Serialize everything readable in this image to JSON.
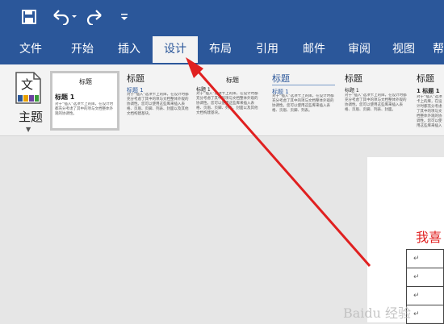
{
  "quick_access": {
    "save_icon": "save-icon",
    "undo_icon": "undo-icon",
    "redo_icon": "redo-icon",
    "customize_icon": "customize-toolbar-icon"
  },
  "tabs": [
    {
      "label": "文件"
    },
    {
      "label": "开始"
    },
    {
      "label": "插入"
    },
    {
      "label": "设计",
      "active": true
    },
    {
      "label": "布局"
    },
    {
      "label": "引用"
    },
    {
      "label": "邮件"
    },
    {
      "label": "审阅"
    },
    {
      "label": "视图"
    },
    {
      "label": "帮"
    }
  ],
  "ribbon": {
    "theme": {
      "icon_text": "文",
      "label": "主题"
    },
    "styles": [
      {
        "title": "标题",
        "heading": "标题 1",
        "body": "对于“插入”选项卡上的库，在设计时都充分考虑了其中的项与文档整体外观的协调性。"
      },
      {
        "title": "标题",
        "heading": "标题 1",
        "body": "对于“插入”选项卡上的库，在设计时都充分考虑了其中的项与文档整体外观的协调性。您可以使用这些库来插入表格、页眉、页脚、列表、封面以及其他文档构建基块。"
      },
      {
        "title": "标题",
        "heading": "标题 1",
        "body": "对于“插入”选项卡上的库，在设计时都充分考虑了其中的项与文档整体外观的协调性。您可以使用这些库来插入表格、页眉、页脚、列表、封面以及其他文档构建基块。"
      },
      {
        "title": "标题",
        "heading": "标题 1",
        "body": "对于“插入”选项卡上的库，在设计时都充分考虑了其中的项与文档整体外观的协调性。您可以使用这些库来插入表格、页眉、页脚、列表。"
      },
      {
        "title": "标题",
        "heading": "标题 1",
        "body": "对于“插入”选项卡上的库，在设计时都充分考虑了其中的项与文档整体外观的协调性。您可以使用这些库来插入表格、页眉、页脚、列表、封面。"
      },
      {
        "title": "标题",
        "heading": "1 标题 1",
        "body": "对于“插入”选项卡上的库，在设计时都充分考虑了其中的项与文档整体外观的协调性。您可以使用这些库来插入表格、页眉。"
      }
    ]
  },
  "document": {
    "heading": "我喜",
    "table_rows": [
      "↵",
      "↵",
      "↵",
      "↵"
    ]
  },
  "watermark": "Baidu 经验",
  "colors": {
    "accent": "#2b579a",
    "annotation_arrow": "#e02020"
  }
}
